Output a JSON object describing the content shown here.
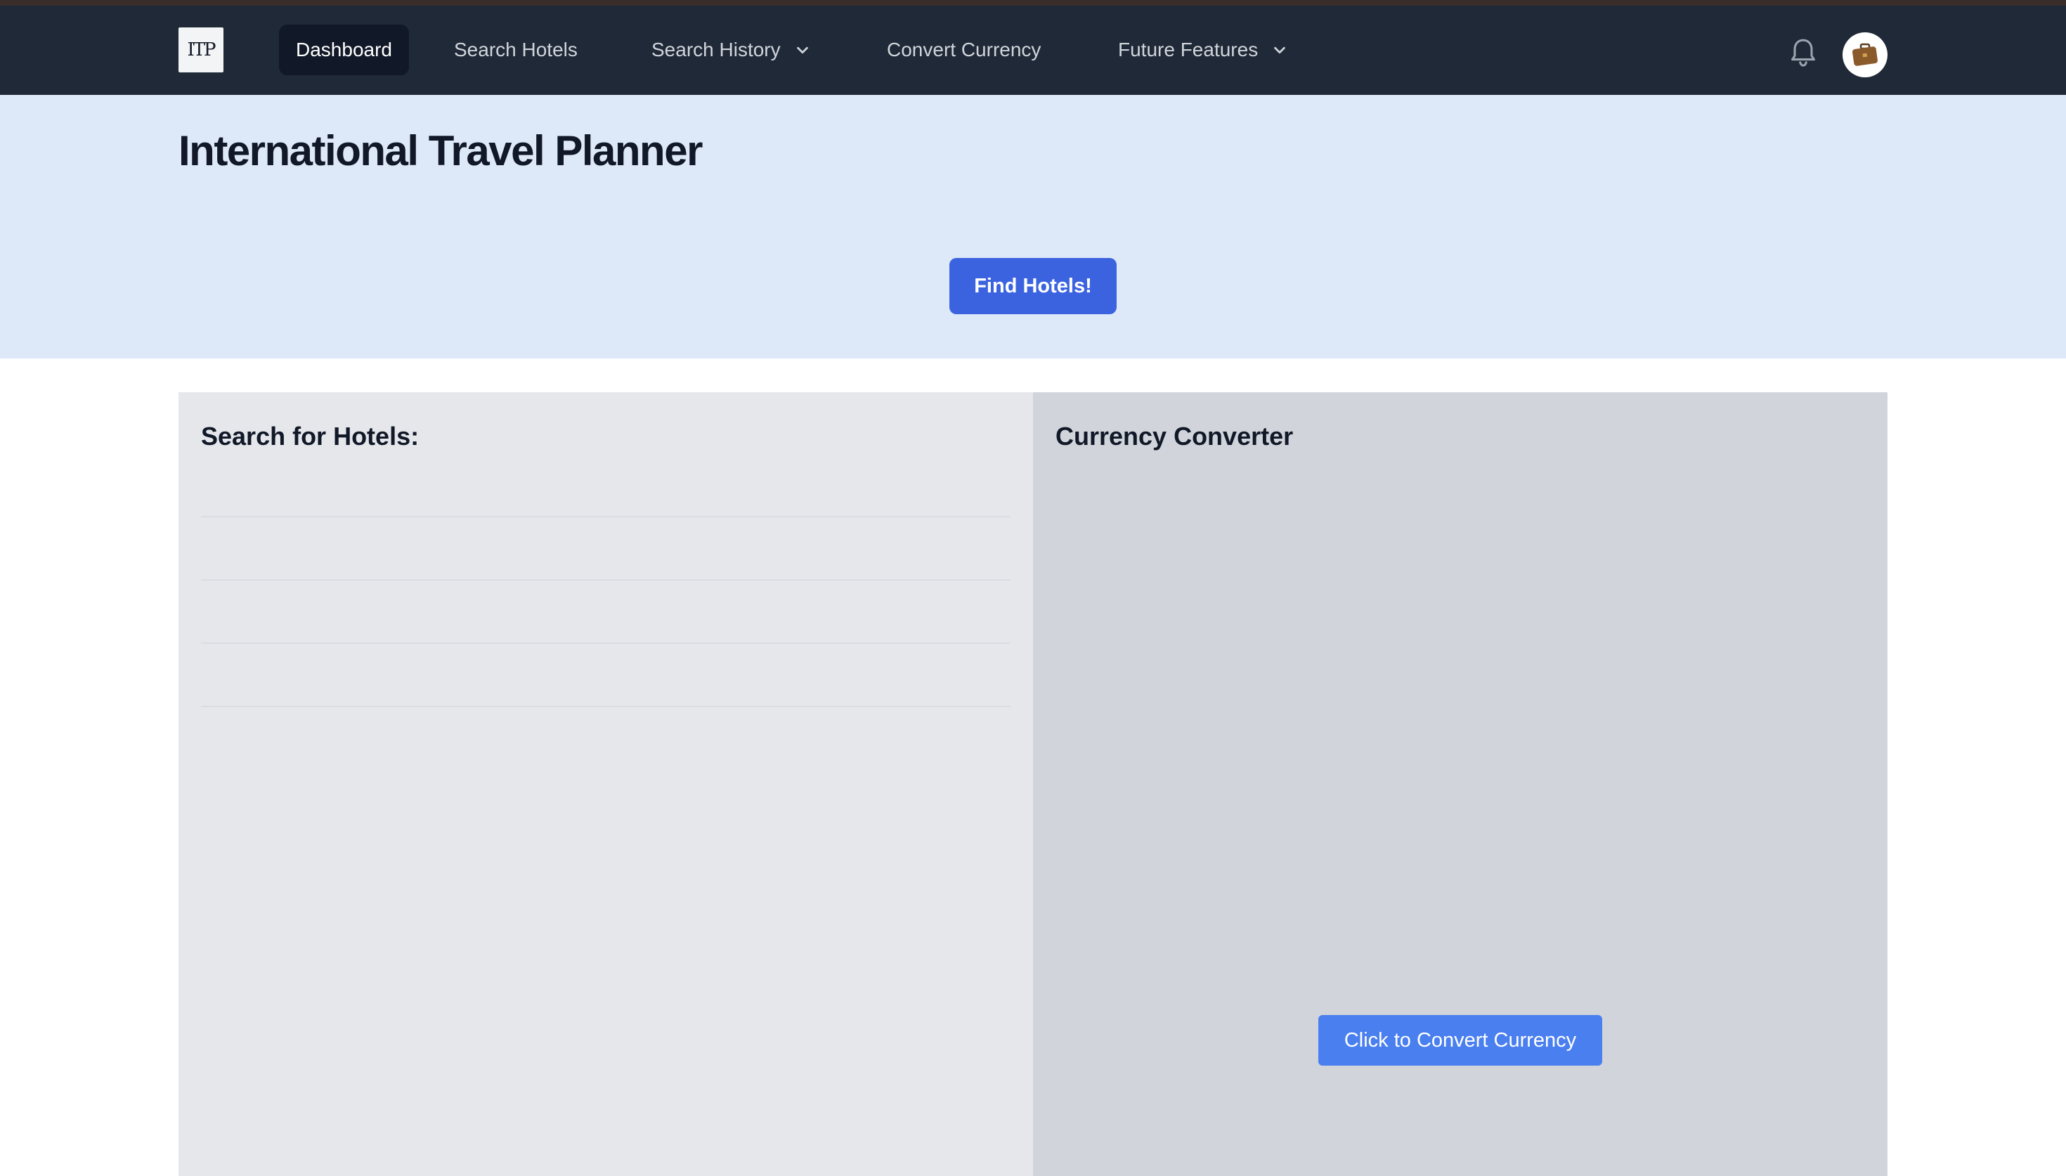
{
  "header": {
    "logo_text": "ITP",
    "nav": [
      {
        "label": "Dashboard",
        "active": true
      },
      {
        "label": "Search Hotels"
      },
      {
        "label": "Search History",
        "dropdown": true
      },
      {
        "label": "Convert Currency"
      },
      {
        "label": "Future Features",
        "dropdown": true
      }
    ],
    "icons": {
      "notifications": "bell-icon",
      "avatar": "briefcase-avatar-icon"
    }
  },
  "hero": {
    "title": "International Travel Planner",
    "cta_label": "Find Hotels!"
  },
  "hotel_panel": {
    "title": "Search for Hotels:"
  },
  "currency_panel": {
    "title": "Currency Converter",
    "button_label": "Click to Convert Currency"
  },
  "colors": {
    "navbar": "#1f2937",
    "hero_bg": "#dde8f9",
    "primary_button": "#3b63e0",
    "convert_button": "#4a7ff0"
  }
}
